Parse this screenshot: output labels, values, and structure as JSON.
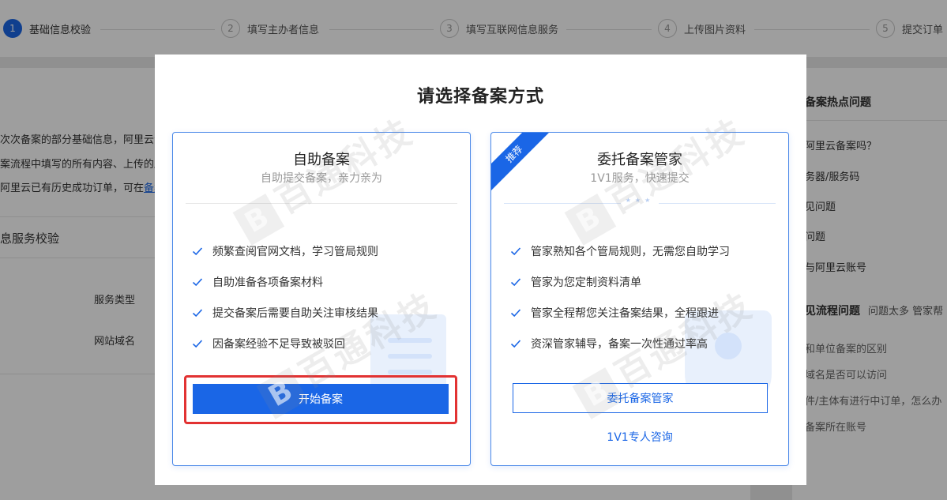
{
  "steps": [
    {
      "num": "1",
      "label": "基础信息校验",
      "active": true
    },
    {
      "num": "2",
      "label": "填写主办者信息",
      "active": false
    },
    {
      "num": "3",
      "label": "填写互联网信息服务",
      "active": false
    },
    {
      "num": "4",
      "label": "上传图片资料",
      "active": false
    },
    {
      "num": "5",
      "label": "提交订单",
      "active": false
    }
  ],
  "background": {
    "lines": [
      {
        "text": "次次备案的部分基础信息，阿里云会"
      },
      {
        "text": "案流程中填写的所有内容、上传的所"
      },
      {
        "text": "阿里云已有历史成功订单，可在",
        "link": "备案"
      }
    ],
    "section_title": "息服务校验",
    "form_labels": [
      "服务类型",
      "网站域名"
    ]
  },
  "sidebar": {
    "title": "备案热点问题",
    "items": [
      "阿里云备案吗？",
      "务器/服务码",
      "见问题",
      "问题",
      "与阿里云账号"
    ],
    "title2": "见流程问题",
    "title2_sub": "问题太多 管家帮",
    "items2": [
      "和单位备案的区别",
      "域名是否可以访问",
      "件/主体有进行中订单，怎么办",
      "备案所在账号"
    ]
  },
  "modal": {
    "title": "请选择备案方式",
    "watermark": "百通科技",
    "self": {
      "title": "自助备案",
      "subtitle": "自助提交备案，亲力亲为",
      "features": [
        "频繁查阅官网文档，学习管局规则",
        "自助准备各项备案材料",
        "提交备案后需要自助关注审核结果",
        "因备案经验不足导致被驳回"
      ],
      "button": "开始备案"
    },
    "managed": {
      "badge": "推荐",
      "title": "委托备案管家",
      "subtitle": "1V1服务，快速提交",
      "features": [
        "管家熟知各个管局规则，无需您自助学习",
        "管家为您定制资料清单",
        "管家全程帮您关注备案结果，全程跟进",
        "资深管家辅导，备案一次性通过率高"
      ],
      "button": "委托备案管家",
      "consult": "1V1专人咨询"
    }
  },
  "colors": {
    "primary": "#1a66e6",
    "highlight": "#e23232",
    "check": "#1a66e6"
  }
}
